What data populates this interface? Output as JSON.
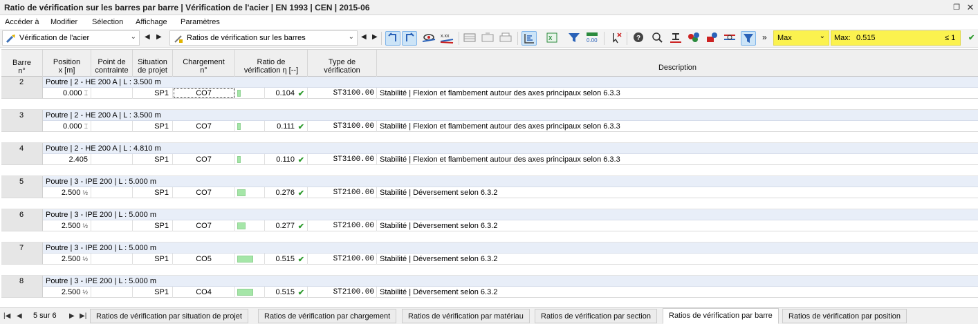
{
  "window": {
    "title": "Ratio de vérification sur les barres par barre | Vérification de l'acier | EN 1993 | CEN | 2015-06",
    "restore_icon": "restore-icon",
    "close_icon": "close-icon"
  },
  "menu": [
    "Accéder à",
    "Modifier",
    "Sélection",
    "Affichage",
    "Paramètres"
  ],
  "toolbar": {
    "module_combo": "Vérification de l'acier",
    "result_combo": "Ratios de vérification sur les barres",
    "more": "»",
    "filter_combo": "Max",
    "max_label": "Max:",
    "max_value": "0.515",
    "le_value": "≤ 1",
    "accent_yellow": "#fbf24f"
  },
  "table": {
    "headers": {
      "barre": [
        "Barre",
        "n°"
      ],
      "position": [
        "Position",
        "x [m]"
      ],
      "point": [
        "Point de",
        "contrainte"
      ],
      "situation": [
        "Situation",
        "de projet"
      ],
      "chargement": [
        "Chargement",
        "n°"
      ],
      "ratio": [
        "Ratio de",
        "vérification η [--]"
      ],
      "type": [
        "Type de",
        "vérification"
      ],
      "description": "Description"
    },
    "rows": [
      {
        "bar": "2",
        "group": "Poutre | 2 - HE 200 A | L : 3.500 m",
        "position": "0.000",
        "pos_mark": "⌶",
        "point": "",
        "situation": "SP1",
        "load": "CO7",
        "ratio": 0.104,
        "ratio_text": "0.104",
        "check": "✔",
        "type": "ST3100.00",
        "description": "Stabilité | Flexion et flambement autour des axes principaux selon 6.3.3"
      },
      {
        "bar": "3",
        "group": "Poutre | 2 - HE 200 A | L : 3.500 m",
        "position": "0.000",
        "pos_mark": "⌶",
        "point": "",
        "situation": "SP1",
        "load": "CO7",
        "ratio": 0.111,
        "ratio_text": "0.111",
        "check": "✔",
        "type": "ST3100.00",
        "description": "Stabilité | Flexion et flambement autour des axes principaux selon 6.3.3"
      },
      {
        "bar": "4",
        "group": "Poutre | 2 - HE 200 A | L : 4.810 m",
        "position": "2.405",
        "pos_mark": "",
        "point": "",
        "situation": "SP1",
        "load": "CO7",
        "ratio": 0.11,
        "ratio_text": "0.110",
        "check": "✔",
        "type": "ST3100.00",
        "description": "Stabilité | Flexion et flambement autour des axes principaux selon 6.3.3"
      },
      {
        "bar": "5",
        "group": "Poutre | 3 - IPE 200 | L : 5.000 m",
        "position": "2.500",
        "pos_mark": "½",
        "point": "",
        "situation": "SP1",
        "load": "CO7",
        "ratio": 0.276,
        "ratio_text": "0.276",
        "check": "✔",
        "type": "ST2100.00",
        "description": "Stabilité | Déversement selon 6.3.2"
      },
      {
        "bar": "6",
        "group": "Poutre | 3 - IPE 200 | L : 5.000 m",
        "position": "2.500",
        "pos_mark": "½",
        "point": "",
        "situation": "SP1",
        "load": "CO7",
        "ratio": 0.277,
        "ratio_text": "0.277",
        "check": "✔",
        "type": "ST2100.00",
        "description": "Stabilité | Déversement selon 6.3.2"
      },
      {
        "bar": "7",
        "group": "Poutre | 3 - IPE 200 | L : 5.000 m",
        "position": "2.500",
        "pos_mark": "½",
        "point": "",
        "situation": "SP1",
        "load": "CO5",
        "ratio": 0.515,
        "ratio_text": "0.515",
        "check": "✔",
        "type": "ST2100.00",
        "description": "Stabilité | Déversement selon 6.3.2"
      },
      {
        "bar": "8",
        "group": "Poutre | 3 - IPE 200 | L : 5.000 m",
        "position": "2.500",
        "pos_mark": "½",
        "point": "",
        "situation": "SP1",
        "load": "CO4",
        "ratio": 0.515,
        "ratio_text": "0.515",
        "check": "✔",
        "type": "ST2100.00",
        "description": "Stabilité | Déversement selon 6.3.2"
      }
    ]
  },
  "pagination": {
    "text": "5 sur 6",
    "first": "⏮",
    "prev": "◀",
    "next": "▶",
    "last": "⏭"
  },
  "tabs": [
    {
      "label": "Ratios de vérification par situation de projet",
      "active": false
    },
    {
      "label": "Ratios de vérification par chargement",
      "active": false
    },
    {
      "label": "Ratios de vérification par matériau",
      "active": false
    },
    {
      "label": "Ratios de vérification par section",
      "active": false
    },
    {
      "label": "Ratios de vérification par barre",
      "active": true
    },
    {
      "label": "Ratios de vérification par position",
      "active": false
    }
  ]
}
